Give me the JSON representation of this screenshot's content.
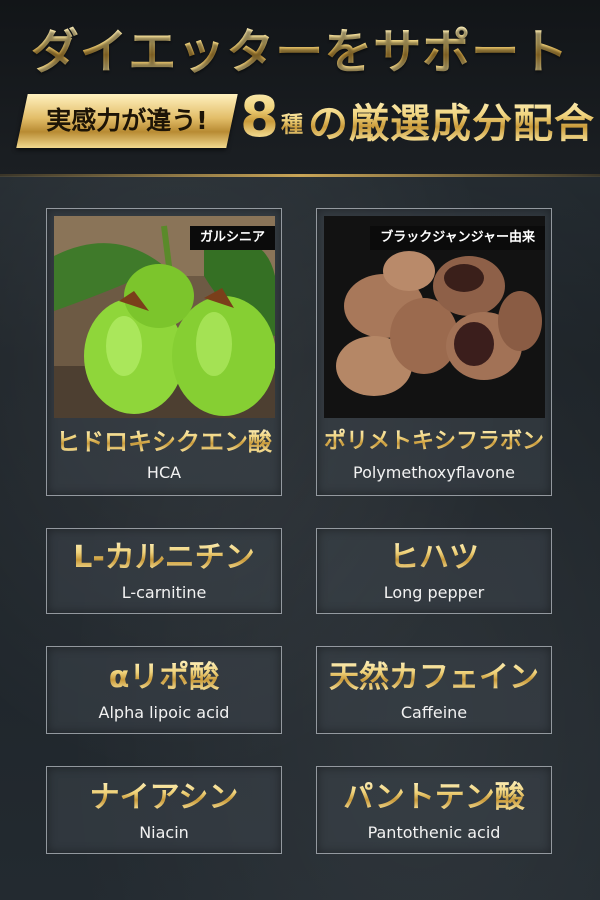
{
  "header": {
    "title": "ダイエッターをサポート",
    "ribbon": "実感力が違う!",
    "number": "8",
    "unit": "種",
    "rest": "の厳選成分配合"
  },
  "ingredients": [
    {
      "photo_tag": "ガルシニア",
      "jp": "ヒドロキシクエン酸",
      "en": "HCA",
      "icon": "garcinia-photo"
    },
    {
      "photo_tag": "ブラックジャンジャー由来",
      "jp": "ポリメトキシフラボン",
      "en": "Polymethoxyflavone",
      "icon": "black-ginger-photo"
    },
    {
      "jp": "L-カルニチン",
      "en": "L-carnitine"
    },
    {
      "jp": "ヒハツ",
      "en": "Long pepper"
    },
    {
      "jp": "αリポ酸",
      "en": "Alpha lipoic acid"
    },
    {
      "jp": "天然カフェイン",
      "en": "Caffeine"
    },
    {
      "jp": "ナイアシン",
      "en": "Niacin"
    },
    {
      "jp": "パントテン酸",
      "en": "Pantothenic acid"
    }
  ],
  "colors": {
    "gold": "#e2bd68",
    "background": "#1c2227",
    "card_border": "#c8cdd2"
  }
}
